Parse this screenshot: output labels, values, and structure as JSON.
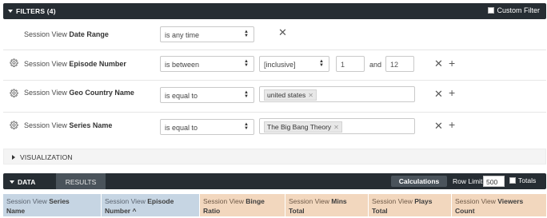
{
  "filters": {
    "title": "FILTERS (4)",
    "custom_filter_label": "Custom Filter",
    "rows": [
      {
        "field_prefix": "Session View",
        "field_name": "Date Range",
        "operator": "is any time"
      },
      {
        "field_prefix": "Session View",
        "field_name": "Episode Number",
        "operator": "is between",
        "range_mode": "[inclusive]",
        "value_low": "1",
        "joiner": "and",
        "value_high": "12"
      },
      {
        "field_prefix": "Session View",
        "field_name": "Geo Country Name",
        "operator": "is equal to",
        "tag": "united states"
      },
      {
        "field_prefix": "Session View",
        "field_name": "Series Name",
        "operator": "is equal to",
        "tag": "The Big Bang Theory"
      }
    ]
  },
  "visualization": {
    "title": "VISUALIZATION"
  },
  "data": {
    "tab_label": "DATA",
    "results_tab_label": "RESULTS",
    "calculations_label": "Calculations",
    "row_limit_label": "Row Limit",
    "row_limit_value": "500",
    "totals_label": "Totals",
    "columns": [
      {
        "prefix": "Session View",
        "name": "Series",
        "second_line": "Name",
        "kind": "dimension"
      },
      {
        "prefix": "Session View",
        "name": "Episode",
        "second_line": "Number ^",
        "kind": "dimension"
      },
      {
        "prefix": "Session View",
        "name": "Binge",
        "second_line": "Ratio",
        "kind": "measure"
      },
      {
        "prefix": "Session View",
        "name": "Mins",
        "second_line": "Total",
        "kind": "measure"
      },
      {
        "prefix": "Session View",
        "name": "Plays",
        "second_line": "Total",
        "kind": "measure"
      },
      {
        "prefix": "Session View",
        "name": "Viewers",
        "second_line": "Count",
        "kind": "measure"
      }
    ]
  },
  "colors": {
    "header_bar": "#262d33",
    "dimension_header": "#c6d5e3",
    "measure_header": "#f2d7be"
  }
}
